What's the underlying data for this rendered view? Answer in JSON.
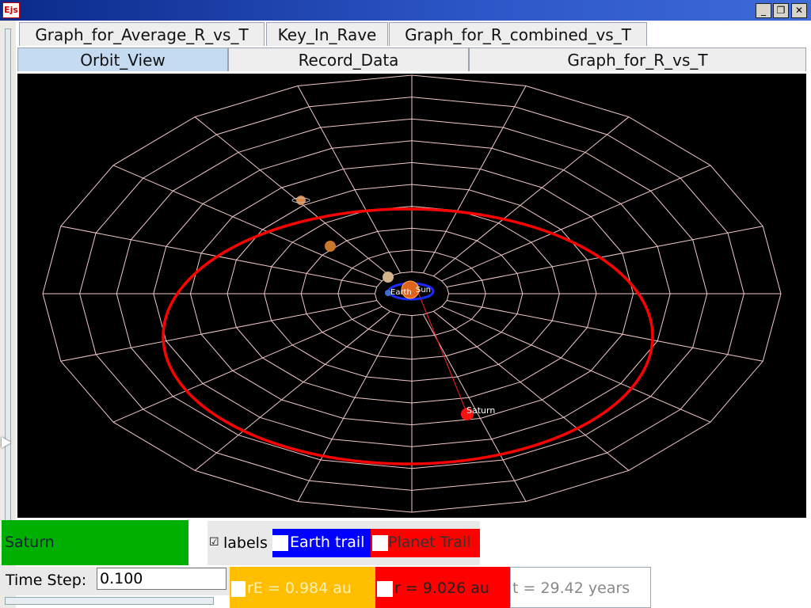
{
  "window": {
    "app_icon": "Ejs",
    "min": "_",
    "restore": "❐",
    "close": "✕"
  },
  "tabs_row1": [
    "Graph_for_Average_R_vs_T",
    "Key_In_Rave",
    "Graph_for_R_combined_vs_T"
  ],
  "tabs_row2": [
    "Orbit_View",
    "Record_Data",
    "Graph_for_R_vs_T"
  ],
  "orbit": {
    "earth_label": "Earth",
    "sun_label": "Sun",
    "planet_label": "Saturn"
  },
  "controls": {
    "planet_button": "Saturn",
    "labels_checkbox": "labels",
    "labels_checked": "☑",
    "earth_trail": "Earth trail",
    "planet_trail": "Planet Trail",
    "time_step_label": "Time Step:",
    "time_step_value": "0.100",
    "rE": "rE = 0.984 au",
    "r": "r = 9.026 au",
    "t": "t = 29.42 years"
  },
  "colors": {
    "planet_button": "#00b000",
    "earth_trail": "#0000ff",
    "planet_trail": "#ff0000",
    "rE_panel": "#ffbf00",
    "r_panel": "#ff0000"
  }
}
